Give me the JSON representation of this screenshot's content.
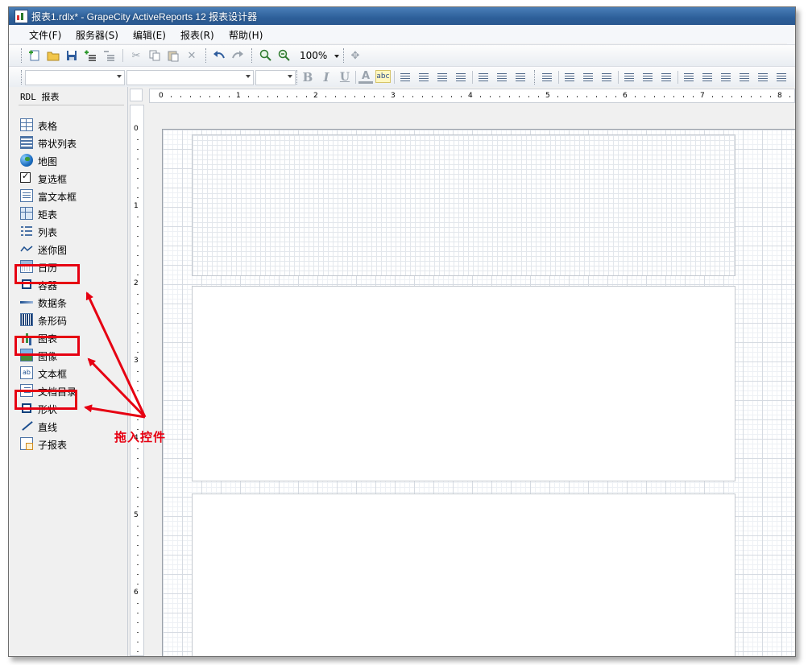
{
  "window": {
    "title": "报表1.rdlx* - GrapeCity ActiveReports 12 报表设计器"
  },
  "menu": {
    "items": [
      {
        "label": "文件(F)"
      },
      {
        "label": "服务器(S)"
      },
      {
        "label": "编辑(E)"
      },
      {
        "label": "报表(R)"
      },
      {
        "label": "帮助(H)"
      }
    ]
  },
  "toolbar": {
    "zoom": "100%",
    "bold": "B",
    "italic": "I",
    "underline": "U",
    "fontcolor": "A",
    "spell": "abc"
  },
  "toolbox": {
    "header": "RDL 报表",
    "items": [
      {
        "label": "表格",
        "icon": "table-icon"
      },
      {
        "label": "带状列表",
        "icon": "banded-list-icon"
      },
      {
        "label": "地图",
        "icon": "globe-icon"
      },
      {
        "label": "复选框",
        "icon": "checkbox-icon"
      },
      {
        "label": "富文本框",
        "icon": "rich-textbox-icon"
      },
      {
        "label": "矩表",
        "icon": "matrix-icon"
      },
      {
        "label": "列表",
        "icon": "list-icon"
      },
      {
        "label": "迷你图",
        "icon": "sparkline-icon"
      },
      {
        "label": "日历",
        "icon": "calendar-icon"
      },
      {
        "label": "容器",
        "icon": "container-icon"
      },
      {
        "label": "数据条",
        "icon": "databar-icon"
      },
      {
        "label": "条形码",
        "icon": "barcode-icon"
      },
      {
        "label": "图表",
        "icon": "chart-icon"
      },
      {
        "label": "图像",
        "icon": "image-icon"
      },
      {
        "label": "文本框",
        "icon": "textbox-icon"
      },
      {
        "label": "文档目录",
        "icon": "table-of-contents-icon"
      },
      {
        "label": "形状",
        "icon": "shape-icon"
      },
      {
        "label": "直线",
        "icon": "line-icon"
      },
      {
        "label": "子报表",
        "icon": "subreport-icon"
      }
    ]
  },
  "ruler": {
    "horizontal": [
      "0",
      "1",
      "2",
      "3",
      "4",
      "5",
      "6",
      "7",
      "8"
    ],
    "vertical": [
      "0",
      "1",
      "2",
      "3",
      "4",
      "5",
      "6"
    ]
  },
  "annotation": {
    "text": "拖入控件",
    "color": "#e60012"
  },
  "colors": {
    "titlebar": "#2d5f99",
    "highlight": "#e60012"
  }
}
